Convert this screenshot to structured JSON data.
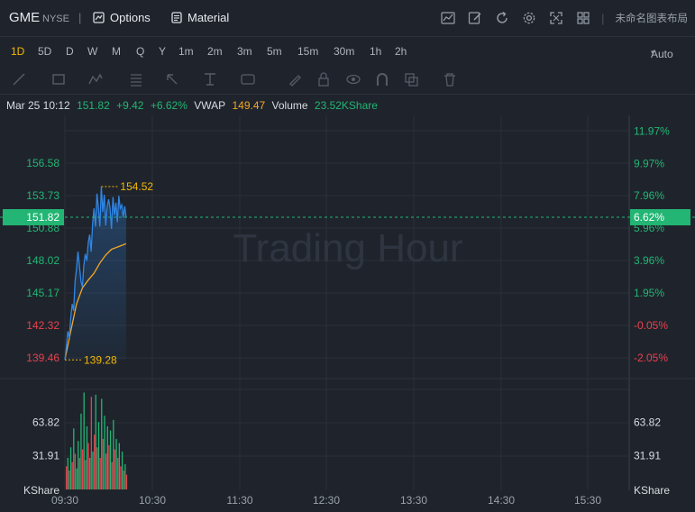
{
  "toolbar": {
    "symbol": "GME",
    "exchange": "NYSE",
    "separator": "|",
    "options_label": "Options",
    "material_label": "Material",
    "layout_label": "未命名图表布局",
    "right_icons": [
      "chart-icon",
      "edit-icon",
      "refresh-icon",
      "settings-icon",
      "fullscreen-icon",
      "grid-layout-icon"
    ]
  },
  "periods": {
    "items": [
      "1D",
      "5D",
      "D",
      "W",
      "M",
      "Q",
      "Y",
      "1m",
      "2m",
      "3m",
      "5m",
      "15m",
      "30m",
      "1h",
      "2h"
    ],
    "active": "1D",
    "auto_label": "Auto"
  },
  "drawing_tools": [
    "line-tool-icon",
    "rect-tool-icon",
    "pattern-tool-icon",
    "fib-tool-icon",
    "arrow-tool-icon",
    "measure-tool-icon",
    "forecast-tool-icon",
    "pen-tool-icon",
    "lock-icon",
    "eye-icon",
    "magnet-icon",
    "copy-icon",
    "trash-icon"
  ],
  "info": {
    "datetime": "Mar 25 10:12",
    "price": "151.82",
    "change": "+9.42",
    "change_pct": "+6.62%",
    "vwap_label": "VWAP",
    "vwap": "149.47",
    "volume_label": "Volume",
    "volume": "23.52KShare"
  },
  "colors": {
    "up": "#22b573",
    "down": "#e8414d",
    "price_line": "#2f86e6",
    "vwap_line": "#f5a623",
    "bg": "#1f242c",
    "grid": "#2b3038"
  },
  "chart_data": {
    "type": "line",
    "watermark": "Trading Hour",
    "x_ticks": [
      "09:30",
      "10:30",
      "11:30",
      "12:30",
      "13:30",
      "14:30",
      "15:30"
    ],
    "ylim": [
      137.9,
      159.4
    ],
    "y_left_ticks": [
      "156.58",
      "153.73",
      "150.88",
      "148.02",
      "145.17",
      "142.32",
      "139.46"
    ],
    "y_left_values": [
      156.58,
      153.73,
      150.88,
      148.02,
      145.17,
      142.32,
      139.46
    ],
    "y_right_ticks": [
      "11.97%",
      "9.97%",
      "7.96%",
      "5.96%",
      "3.96%",
      "1.95%",
      "-0.05%",
      "-2.05%"
    ],
    "y_right_values": [
      159.41,
      156.56,
      153.72,
      150.87,
      148.02,
      145.17,
      142.33,
      139.47
    ],
    "current_price": "151.82",
    "current_pct": "6.62%",
    "high_label": "154.52",
    "low_label": "139.28",
    "series": [
      {
        "name": "Price",
        "x_minutes": [
          0,
          1,
          2,
          3,
          4,
          5,
          6,
          7,
          8,
          9,
          10,
          11,
          12,
          13,
          14,
          15,
          16,
          17,
          18,
          19,
          20,
          21,
          22,
          23,
          24,
          25,
          26,
          27,
          28,
          29,
          30,
          31,
          32,
          33,
          34,
          35,
          36,
          37,
          38,
          39,
          40,
          41,
          42
        ],
        "values": [
          139.3,
          140.4,
          141.8,
          141.2,
          143.0,
          144.2,
          143.6,
          146.2,
          147.3,
          148.8,
          147.5,
          146.2,
          145.7,
          147.6,
          148.6,
          148.0,
          149.6,
          150.3,
          148.8,
          151.2,
          152.6,
          151.0,
          153.9,
          152.6,
          151.0,
          154.5,
          152.3,
          153.8,
          151.1,
          152.8,
          153.4,
          152.6,
          150.8,
          153.6,
          152.0,
          153.1,
          151.4,
          153.7,
          152.6,
          152.9,
          151.8,
          152.8,
          151.8
        ]
      },
      {
        "name": "VWAP",
        "x_minutes": [
          0,
          4,
          8,
          12,
          16,
          20,
          24,
          28,
          32,
          36,
          40,
          42
        ],
        "values": [
          139.3,
          141.8,
          144.2,
          145.6,
          146.3,
          146.9,
          147.8,
          148.5,
          149.0,
          149.2,
          149.4,
          149.5
        ]
      }
    ],
    "volume": {
      "y_ticks": [
        "63.82",
        "31.91"
      ],
      "y_values": [
        63.82,
        31.91
      ],
      "ymax": 95,
      "unit_label": "KShare",
      "bars": [
        {
          "v": 22,
          "c": "down"
        },
        {
          "v": 30,
          "c": "up"
        },
        {
          "v": 18,
          "c": "down"
        },
        {
          "v": 40,
          "c": "up"
        },
        {
          "v": 26,
          "c": "down"
        },
        {
          "v": 58,
          "c": "up"
        },
        {
          "v": 34,
          "c": "down"
        },
        {
          "v": 20,
          "c": "up"
        },
        {
          "v": 46,
          "c": "up"
        },
        {
          "v": 30,
          "c": "down"
        },
        {
          "v": 72,
          "c": "up"
        },
        {
          "v": 38,
          "c": "down"
        },
        {
          "v": 92,
          "c": "up"
        },
        {
          "v": 28,
          "c": "down"
        },
        {
          "v": 60,
          "c": "up"
        },
        {
          "v": 44,
          "c": "down"
        },
        {
          "v": 30,
          "c": "up"
        },
        {
          "v": 88,
          "c": "down"
        },
        {
          "v": 36,
          "c": "up"
        },
        {
          "v": 52,
          "c": "down"
        },
        {
          "v": 90,
          "c": "up"
        },
        {
          "v": 40,
          "c": "down"
        },
        {
          "v": 64,
          "c": "up"
        },
        {
          "v": 30,
          "c": "down"
        },
        {
          "v": 86,
          "c": "up"
        },
        {
          "v": 48,
          "c": "down"
        },
        {
          "v": 70,
          "c": "up"
        },
        {
          "v": 34,
          "c": "down"
        },
        {
          "v": 60,
          "c": "up"
        },
        {
          "v": 42,
          "c": "down"
        },
        {
          "v": 56,
          "c": "up"
        },
        {
          "v": 26,
          "c": "down"
        },
        {
          "v": 66,
          "c": "up"
        },
        {
          "v": 38,
          "c": "down"
        },
        {
          "v": 48,
          "c": "up"
        },
        {
          "v": 30,
          "c": "down"
        },
        {
          "v": 44,
          "c": "up"
        },
        {
          "v": 22,
          "c": "down"
        },
        {
          "v": 36,
          "c": "up"
        },
        {
          "v": 18,
          "c": "down"
        },
        {
          "v": 24,
          "c": "up"
        },
        {
          "v": 14,
          "c": "down"
        }
      ]
    }
  }
}
